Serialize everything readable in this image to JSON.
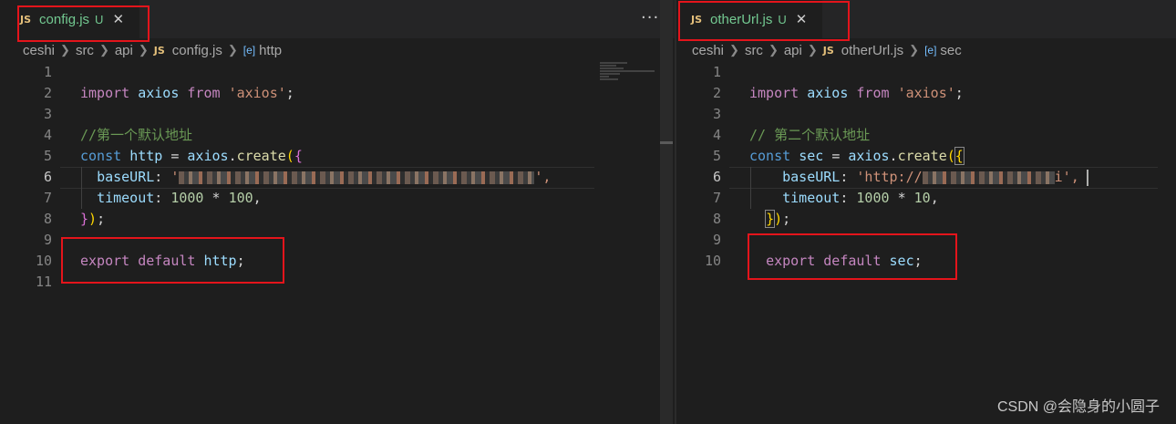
{
  "left": {
    "tab": {
      "icon": "JS",
      "name": "config.js",
      "status": "U",
      "close": "✕"
    },
    "more": "···",
    "breadcrumb": {
      "folder1": "ceshi",
      "folder2": "src",
      "folder3": "api",
      "file_icon": "JS",
      "file": "config.js",
      "symbol_icon": "[e]",
      "symbol": "http"
    },
    "lines": [
      "1",
      "2",
      "3",
      "4",
      "5",
      "6",
      "7",
      "8",
      "9",
      "10",
      "11"
    ],
    "code": {
      "l2_import": "import",
      "l2_axios": "axios",
      "l2_from": "from",
      "l2_str": "'axios'",
      "l2_semi": ";",
      "l4_comment": "//第一个默认地址",
      "l5_const": "const",
      "l5_var": "http",
      "l5_eq": "=",
      "l5_obj": "axios",
      "l5_dot": ".",
      "l5_fn": "create",
      "l5_paren": "(",
      "l5_brace": "{",
      "l6_key": "baseURL",
      "l6_colon": ":",
      "l6_q": "'",
      "l6_end": "',",
      "l7_key": "timeout",
      "l7_colon": ":",
      "l7_num1": "1000",
      "l7_op": "*",
      "l7_num2": "100",
      "l7_comma": ",",
      "l8_brace": "}",
      "l8_paren": ")",
      "l8_semi": ";",
      "l10_export": "export",
      "l10_default": "default",
      "l10_var": "http",
      "l10_semi": ";"
    }
  },
  "right": {
    "tab": {
      "icon": "JS",
      "name": "otherUrl.js",
      "status": "U",
      "close": "✕"
    },
    "breadcrumb": {
      "folder1": "ceshi",
      "folder2": "src",
      "folder3": "api",
      "file_icon": "JS",
      "file": "otherUrl.js",
      "symbol_icon": "[e]",
      "symbol": "sec"
    },
    "lines": [
      "1",
      "2",
      "3",
      "4",
      "5",
      "6",
      "7",
      "8",
      "9",
      "10"
    ],
    "code": {
      "l2_import": "import",
      "l2_axios": "axios",
      "l2_from": "from",
      "l2_str": "'axios'",
      "l2_semi": ";",
      "l4_comment": "// 第二个默认地址",
      "l5_const": "const",
      "l5_var": "sec",
      "l5_eq": "=",
      "l5_obj": "axios",
      "l5_dot": ".",
      "l5_fn": "create",
      "l5_paren": "(",
      "l5_brace": "{",
      "l6_key": "baseURL",
      "l6_colon": ":",
      "l6_str_start": "'http://",
      "l6_str_end": "i',",
      "l7_key": "timeout",
      "l7_colon": ":",
      "l7_num1": "1000",
      "l7_op": "*",
      "l7_num2": "10",
      "l7_comma": ",",
      "l8_brace": "}",
      "l8_paren": ")",
      "l8_semi": ";",
      "l10_export": "export",
      "l10_default": "default",
      "l10_var": "sec",
      "l10_semi": ";"
    }
  },
  "watermark": "CSDN @会隐身的小圆子",
  "colors": {
    "accent_red": "#e4141b",
    "background": "#1e1e1e",
    "tab_modified": "#73c991"
  }
}
